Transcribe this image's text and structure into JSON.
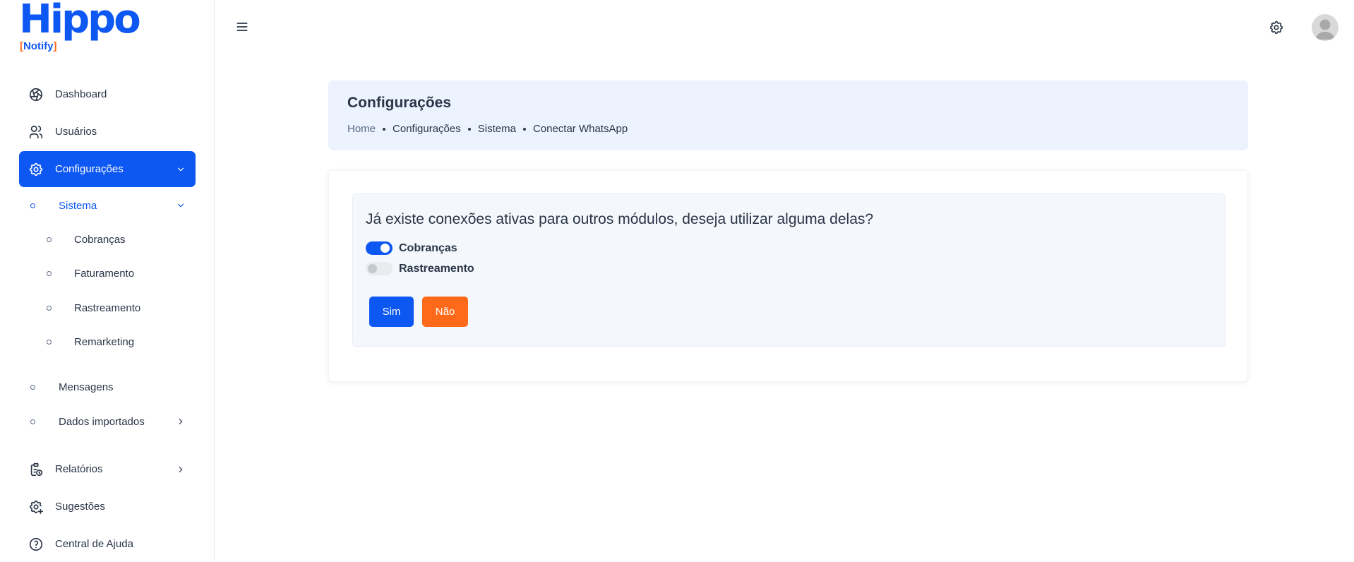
{
  "brand": {
    "word": "Hippo",
    "tag_open": "[",
    "tag_text": "Notify",
    "tag_close": "]",
    "primary_color": "#0d57f2",
    "accent_color": "#ff6a1a"
  },
  "sidebar": {
    "items": [
      {
        "label": "Dashboard",
        "icon": "aperture-icon"
      },
      {
        "label": "Usuários",
        "icon": "users-icon"
      },
      {
        "label": "Configurações",
        "icon": "settings-icon",
        "active": true
      },
      {
        "label": "Relatórios",
        "icon": "clipboard-clock-icon"
      },
      {
        "label": "Sugestões",
        "icon": "settings-plus-icon"
      },
      {
        "label": "Central de Ajuda",
        "icon": "help-circle-icon"
      }
    ],
    "submenu": {
      "sistema": "Sistema",
      "sistema_children": [
        "Cobranças",
        "Faturamento",
        "Rastreamento",
        "Remarketing"
      ],
      "mensagens": "Mensagens",
      "dados_importados": "Dados importados"
    }
  },
  "header": {
    "menu_icon": "hamburger-icon",
    "settings_icon": "gear-icon",
    "avatar_icon": "user-avatar"
  },
  "page": {
    "title": "Configurações",
    "breadcrumbs": [
      "Home",
      "Configurações",
      "Sistema",
      "Conectar WhatsApp"
    ]
  },
  "panel": {
    "question": "Já existe conexões ativas para outros módulos, deseja utilizar alguma delas?",
    "toggles": [
      {
        "label": "Cobranças",
        "checked": true
      },
      {
        "label": "Rastreamento",
        "checked": false
      }
    ],
    "yes_label": "Sim",
    "no_label": "Não"
  }
}
